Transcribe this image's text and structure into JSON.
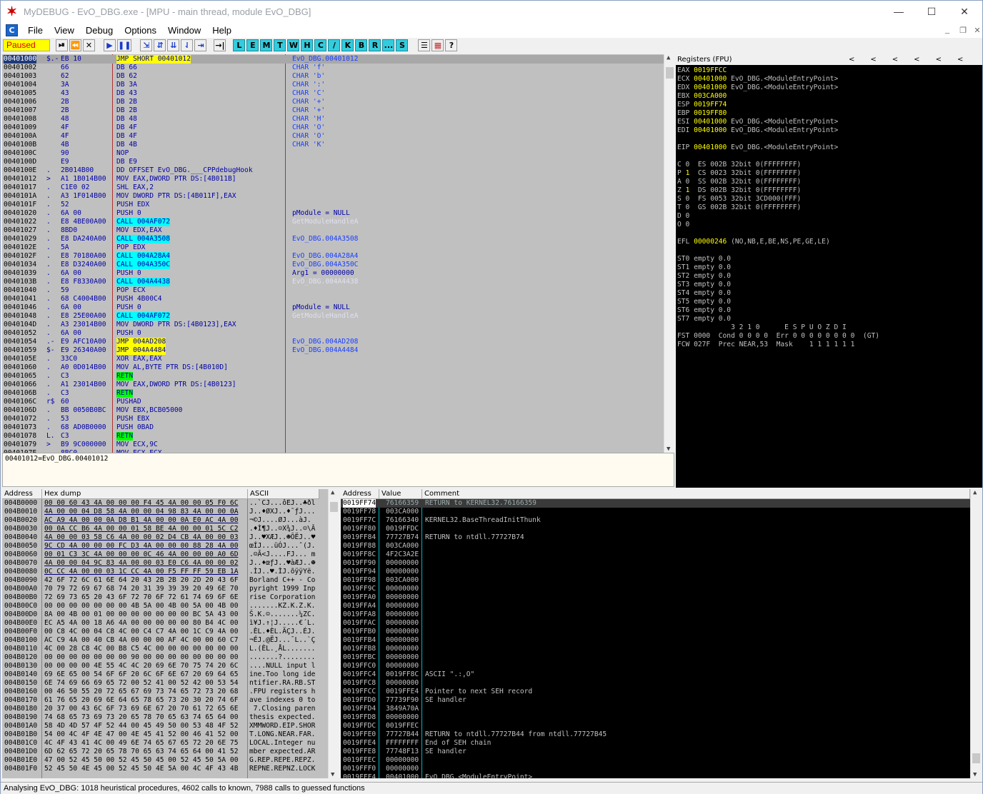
{
  "window": {
    "title": "MyDEBUG - EvO_DBG.exe - [MPU - main thread, module EvO_DBG]",
    "minimize": "—",
    "maximize": "☐",
    "close": "✕"
  },
  "menu": [
    "File",
    "View",
    "Debug",
    "Options",
    "Window",
    "Help"
  ],
  "toolbar": {
    "status": "Paused",
    "buttons": [
      "⏯",
      "⏪",
      "✕",
      "▶",
      "❚❚",
      "⇲",
      "⇵",
      "⇊",
      "⇃",
      "⇥",
      "→|"
    ],
    "letter_buttons": [
      "L",
      "E",
      "M",
      "T",
      "W",
      "H",
      "C",
      "/",
      "K",
      "B",
      "R",
      "...",
      "S"
    ],
    "misc_buttons": [
      "☰",
      "▦",
      "?"
    ]
  },
  "disasm": [
    [
      "00401000",
      "$.-",
      "EB 10",
      "JMP SHORT 00401012",
      "EvO_DBG.00401012"
    ],
    [
      "00401002",
      "",
      "66",
      "DB 66",
      "CHAR 'f'"
    ],
    [
      "00401003",
      "",
      "62",
      "DB 62",
      "CHAR 'b'"
    ],
    [
      "00401004",
      "",
      "3A",
      "DB 3A",
      "CHAR ':'"
    ],
    [
      "00401005",
      "",
      "43",
      "DB 43",
      "CHAR 'C'"
    ],
    [
      "00401006",
      "",
      "2B",
      "DB 2B",
      "CHAR '+'"
    ],
    [
      "00401007",
      "",
      "2B",
      "DB 2B",
      "CHAR '+'"
    ],
    [
      "00401008",
      "",
      "48",
      "DB 48",
      "CHAR 'H'"
    ],
    [
      "00401009",
      "",
      "4F",
      "DB 4F",
      "CHAR 'O'"
    ],
    [
      "0040100A",
      "",
      "4F",
      "DB 4F",
      "CHAR 'O'"
    ],
    [
      "0040100B",
      "",
      "4B",
      "DB 4B",
      "CHAR 'K'"
    ],
    [
      "0040100C",
      "",
      "90",
      "NOP",
      ""
    ],
    [
      "0040100D",
      "",
      "E9",
      "DB E9",
      ""
    ],
    [
      "0040100E",
      ".",
      "2B014B00",
      "DD OFFSET EvO_DBG.___CPPdebugHook",
      ""
    ],
    [
      "00401012",
      ">",
      "A1 1B014B00",
      "MOV EAX,DWORD PTR DS:[4B011B]",
      ""
    ],
    [
      "00401017",
      ".",
      "C1E0 02",
      "SHL EAX,2",
      ""
    ],
    [
      "0040101A",
      ".",
      "A3 1F014B00",
      "MOV DWORD PTR DS:[4B011F],EAX",
      ""
    ],
    [
      "0040101F",
      ".",
      "52",
      "PUSH EDX",
      ""
    ],
    [
      "00401020",
      ".",
      "6A 00",
      "PUSH 0",
      "pModule = NULL"
    ],
    [
      "00401022",
      ".",
      "E8 4BE00A00",
      "CALL 004AF072",
      "GetModuleHandleA"
    ],
    [
      "00401027",
      ".",
      "8BD0",
      "MOV EDX,EAX",
      ""
    ],
    [
      "00401029",
      ".",
      "E8 DA240A00",
      "CALL 004A3508",
      "EvO_DBG.004A3508"
    ],
    [
      "0040102E",
      ".",
      "5A",
      "POP EDX",
      ""
    ],
    [
      "0040102F",
      ".",
      "E8 70180A00",
      "CALL 004A28A4",
      "EvO_DBG.004A28A4"
    ],
    [
      "00401034",
      ".",
      "E8 D3240A00",
      "CALL 004A350C",
      "EvO_DBG.004A350C"
    ],
    [
      "00401039",
      ".",
      "6A 00",
      "PUSH 0",
      "Arg1 = 00000000"
    ],
    [
      "0040103B",
      ".",
      "E8 F8330A00",
      "CALL 004A4438",
      "EvO_DBG.004A4438"
    ],
    [
      "00401040",
      ".",
      "59",
      "POP ECX",
      ""
    ],
    [
      "00401041",
      ".",
      "68 C4004B00",
      "PUSH 4B00C4",
      ""
    ],
    [
      "00401046",
      ".",
      "6A 00",
      "PUSH 0",
      "pModule = NULL"
    ],
    [
      "00401048",
      ".",
      "E8 25E00A00",
      "CALL 004AF072",
      "GetModuleHandleA"
    ],
    [
      "0040104D",
      ".",
      "A3 23014B00",
      "MOV DWORD PTR DS:[4B0123],EAX",
      ""
    ],
    [
      "00401052",
      ".",
      "6A 00",
      "PUSH 0",
      ""
    ],
    [
      "00401054",
      ".-",
      "E9 AFC10A00",
      "JMP 004AD208",
      "EvO_DBG.004AD208"
    ],
    [
      "00401059",
      "$-",
      "E9 26340A00",
      "JMP 004A4484",
      "EvO_DBG.004A4484"
    ],
    [
      "0040105E",
      ".",
      "33C0",
      "XOR EAX,EAX",
      ""
    ],
    [
      "00401060",
      ".",
      "A0 0D014B00",
      "MOV AL,BYTE PTR DS:[4B010D]",
      ""
    ],
    [
      "00401065",
      ".",
      "C3",
      "RETN",
      ""
    ],
    [
      "00401066",
      ".",
      "A1 23014B00",
      "MOV EAX,DWORD PTR DS:[4B0123]",
      ""
    ],
    [
      "0040106B",
      ".",
      "C3",
      "RETN",
      ""
    ],
    [
      "0040106C",
      "r$",
      "60",
      "PUSHAD",
      ""
    ],
    [
      "0040106D",
      ".",
      "BB 0050B0BC",
      "MOV EBX,BCB05000",
      ""
    ],
    [
      "00401072",
      ".",
      "53",
      "PUSH EBX",
      ""
    ],
    [
      "00401073",
      ".",
      "68 AD0B0000",
      "PUSH 0BAD",
      ""
    ],
    [
      "00401078",
      "L.",
      "C3",
      "RETN",
      ""
    ],
    [
      "00401079",
      ">",
      "B9 9C000000",
      "MOV ECX,9C",
      ""
    ],
    [
      "0040107E",
      ".",
      "8BC0",
      "MOV ECX,ECX",
      ""
    ]
  ],
  "info_line": "00401012=EvO_DBG.00401012",
  "registers": {
    "title": "Registers (FPU)",
    "arrows": [
      "<",
      "<",
      "<",
      "<",
      "<",
      "<"
    ],
    "lines": [
      [
        "EAX",
        "0019FFCC",
        ""
      ],
      [
        "ECX",
        "00401000",
        "EvO_DBG.<ModuleEntryPoint>"
      ],
      [
        "EDX",
        "00401000",
        "EvO_DBG.<ModuleEntryPoint>"
      ],
      [
        "EBX",
        "003CA000",
        ""
      ],
      [
        "ESP",
        "0019FF74",
        ""
      ],
      [
        "EBP",
        "0019FF80",
        ""
      ],
      [
        "ESI",
        "00401000",
        "EvO_DBG.<ModuleEntryPoint>"
      ],
      [
        "EDI",
        "00401000",
        "EvO_DBG.<ModuleEntryPoint>"
      ],
      [
        "",
        "",
        ""
      ],
      [
        "EIP",
        "00401000",
        "EvO_DBG.<ModuleEntryPoint>"
      ]
    ],
    "flags": [
      "C 0  ES 002B 32bit 0(FFFFFFFF)",
      "P 1  CS 0023 32bit 0(FFFFFFFF)",
      "A 0  SS 002B 32bit 0(FFFFFFFF)",
      "Z 1  DS 002B 32bit 0(FFFFFFFF)",
      "S 0  FS 0053 32bit 3CD000(FFF)",
      "T 0  GS 002B 32bit 0(FFFFFFFF)",
      "D 0",
      "O 0"
    ],
    "efl_label": "EFL",
    "efl_value": "00000246",
    "efl_desc": "(NO,NB,E,BE,NS,PE,GE,LE)",
    "fpu": [
      "ST0 empty 0.0",
      "ST1 empty 0.0",
      "ST2 empty 0.0",
      "ST3 empty 0.0",
      "ST4 empty 0.0",
      "ST5 empty 0.0",
      "ST6 empty 0.0",
      "ST7 empty 0.0",
      "             3 2 1 0      E S P U O Z D I",
      "FST 0000  Cond 0 0 0 0  Err 0 0 0 0 0 0 0 0  (GT)",
      "FCW 027F  Prec NEAR,53  Mask    1 1 1 1 1 1"
    ]
  },
  "dump": {
    "headers": [
      "Address",
      "Hex dump",
      "ASCII"
    ],
    "rows": [
      [
        "004B0000",
        "00 00 60 43 4A 00 00 00 F4 45 4A 00 00 05 F0 6C",
        "..`CJ...ôEJ..♣ðl"
      ],
      [
        "004B0010",
        "4A 00 00 04 D8 58 4A 00 00 04 98 83 4A 00 00 0A",
        "J..♦ØXJ..♦˜ƒJ..."
      ],
      [
        "004B0020",
        "AC A9 4A 00 00 0A D8 B1 4A 00 00 0A E0 AC 4A 00",
        "¬©J....ØJ...àJ."
      ],
      [
        "004B0030",
        "00 0A CC B6 4A 00 00 01 58 BE 4A 00 00 01 5C C2",
        ".♦Ì¶J..☺X¾J..☺\\Â"
      ],
      [
        "004B0040",
        "4A 00 00 03 58 C6 4A 00 00 02 D4 CB 4A 00 00 03",
        "J..♥XÆJ..☻ÔËJ..♥"
      ],
      [
        "004B0050",
        "9C CD 4A 00 00 00 FC D3 4A 00 00 00 88 28 4A 00",
        "œÍJ...üÓJ...ˆ(J."
      ],
      [
        "004B0060",
        "00 01 C3 3C 4A 00 00 00 0C 46 4A 00 00 00 A0 6D",
        ".☺Ã<J....FJ... m"
      ],
      [
        "004B0070",
        "4A 00 00 04 9C 83 4A 00 00 03 E0 C6 4A 00 00 02",
        "J..♦œƒJ..♥àÆJ..☻"
      ],
      [
        "004B0080",
        "0C CC 4A 00 00 03 1C CC 4A 00 F5 FF FF 59 EB 1A",
        ".ÌJ..♥.ÌJ.õÿÿYë."
      ],
      [
        "004B0090",
        "42 6F 72 6C 61 6E 64 20 43 2B 2B 20 2D 20 43 6F",
        "Borland C++ - Co"
      ],
      [
        "004B00A0",
        "70 79 72 69 67 68 74 20 31 39 39 39 20 49 6E 70",
        "pyright 1999 Inp"
      ],
      [
        "004B00B0",
        "72 69 73 65 20 43 6F 72 70 6F 72 61 74 69 6F 6E",
        "rise Corporation"
      ],
      [
        "004B00C0",
        "00 00 00 00 00 00 00 4B 5A 00 4B 00 5A 00 4B 00",
        ".......KZ.K.Z.K."
      ],
      [
        "004B00D0",
        "8A 00 4B 00 01 00 00 00 00 00 00 00 BC 5A 43 00",
        "Š.K.☺.......¼ZC."
      ],
      [
        "004B00E0",
        "EC A5 4A 00 18 A6 4A 00 00 00 00 00 80 B4 4C 00",
        "ì¥J.↑¦J.....€´L."
      ],
      [
        "004B00F0",
        "00 C8 4C 00 04 C8 4C 00 C4 C7 4A 00 1C C9 4A 00",
        ".ÈL.♦ÈL.ÄÇJ..ÉJ."
      ],
      [
        "004B0100",
        "AC C9 4A 00 40 CB 4A 00 00 00 AF 4C 00 00 60 C7",
        "¬ÉJ.@ËJ...¯L..`Ç"
      ],
      [
        "004B0110",
        "4C 00 28 C8 4C 00 B8 C5 4C 00 00 00 00 00 00 00",
        "L.(ÈL.¸ÅL......."
      ],
      [
        "004B0120",
        "00 00 00 00 00 00 00 90 00 00 00 00 00 00 00 00",
        ".......?........"
      ],
      [
        "004B0130",
        "00 00 00 00 4E 55 4C 4C 20 69 6E 70 75 74 20 6C",
        "....NULL input l"
      ],
      [
        "004B0140",
        "69 6E 65 00 54 6F 6F 20 6C 6F 6E 67 20 69 64 65",
        "ine.Too long ide"
      ],
      [
        "004B0150",
        "6E 74 69 66 69 65 72 00 52 41 00 52 42 00 53 54",
        "ntifier.RA.RB.ST"
      ],
      [
        "004B0160",
        "00 46 50 55 20 72 65 67 69 73 74 65 72 73 20 68",
        ".FPU registers h"
      ],
      [
        "004B0170",
        "61 76 65 20 69 6E 64 65 78 65 73 20 30 20 74 6F",
        "ave indexes 0 to"
      ],
      [
        "004B0180",
        "20 37 00 43 6C 6F 73 69 6E 67 20 70 61 72 65 6E",
        " 7.Closing paren"
      ],
      [
        "004B0190",
        "74 68 65 73 69 73 20 65 78 70 65 63 74 65 64 00",
        "thesis expected."
      ],
      [
        "004B01A0",
        "58 4D 4D 57 4F 52 44 00 45 49 50 00 53 48 4F 52",
        "XMMWORD.EIP.SHOR"
      ],
      [
        "004B01B0",
        "54 00 4C 4F 4E 47 00 4E 45 41 52 00 46 41 52 00",
        "T.LONG.NEAR.FAR."
      ],
      [
        "004B01C0",
        "4C 4F 43 41 4C 00 49 6E 74 65 67 65 72 20 6E 75",
        "LOCAL.Integer nu"
      ],
      [
        "004B01D0",
        "6D 62 65 72 20 65 78 70 65 63 74 65 64 00 41 52",
        "mber expected.AR"
      ],
      [
        "004B01E0",
        "47 00 52 45 50 00 52 45 50 45 00 52 45 50 5A 00",
        "G.REP.REPE.REPZ."
      ],
      [
        "004B01F0",
        "52 45 50 4E 45 00 52 45 50 4E 5A 00 4C 4F 43 4B",
        "REPNE.REPNZ.LOCK"
      ]
    ]
  },
  "stack": {
    "headers": [
      "Address",
      "Value",
      "Comment"
    ],
    "rows": [
      [
        "0019FF74",
        "76166359",
        "RETURN to KERNEL32.76166359"
      ],
      [
        "0019FF78",
        "003CA000",
        ""
      ],
      [
        "0019FF7C",
        "76166340",
        "KERNEL32.BaseThreadInitThunk"
      ],
      [
        "0019FF80",
        "0019FFDC",
        ""
      ],
      [
        "0019FF84",
        "77727B74",
        "RETURN to ntdll.77727B74"
      ],
      [
        "0019FF88",
        "003CA000",
        ""
      ],
      [
        "0019FF8C",
        "4F2C3A2E",
        ""
      ],
      [
        "0019FF90",
        "00000000",
        ""
      ],
      [
        "0019FF94",
        "00000000",
        ""
      ],
      [
        "0019FF98",
        "003CA000",
        ""
      ],
      [
        "0019FF9C",
        "00000000",
        ""
      ],
      [
        "0019FFA0",
        "00000000",
        ""
      ],
      [
        "0019FFA4",
        "00000000",
        ""
      ],
      [
        "0019FFA8",
        "00000000",
        ""
      ],
      [
        "0019FFAC",
        "00000000",
        ""
      ],
      [
        "0019FFB0",
        "00000000",
        ""
      ],
      [
        "0019FFB4",
        "00000000",
        ""
      ],
      [
        "0019FFB8",
        "00000000",
        ""
      ],
      [
        "0019FFBC",
        "00000000",
        ""
      ],
      [
        "0019FFC0",
        "00000000",
        ""
      ],
      [
        "0019FFC4",
        "0019FF8C",
        "ASCII \".:,O\""
      ],
      [
        "0019FFC8",
        "00000000",
        ""
      ],
      [
        "0019FFCC",
        "0019FFE4",
        "Pointer to next SEH record"
      ],
      [
        "0019FFD0",
        "77739F90",
        "SE handler"
      ],
      [
        "0019FFD4",
        "3849A70A",
        ""
      ],
      [
        "0019FFD8",
        "00000000",
        ""
      ],
      [
        "0019FFDC",
        "0019FFEC",
        ""
      ],
      [
        "0019FFE0",
        "77727B44",
        "RETURN to ntdll.77727B44 from ntdll.77727B45"
      ],
      [
        "0019FFE4",
        "FFFFFFFF",
        "End of SEH chain"
      ],
      [
        "0019FFE8",
        "77748F13",
        "SE handler"
      ],
      [
        "0019FFEC",
        "00000000",
        ""
      ],
      [
        "0019FFF0",
        "00000000",
        ""
      ],
      [
        "0019FFF4",
        "00401000",
        "EvO_DBG.<ModuleEntryPoint>"
      ]
    ]
  },
  "statusbar": "Analysing EvO_DBG: 1018 heuristical procedures, 4602 calls to known, 7988 calls to guessed functions",
  "colors": {
    "highlight_yellow": "#ffff00",
    "highlight_cyan": "#00ffff",
    "highlight_green": "#00ff00",
    "register_bg": "#000000",
    "register_changed": "#ffff00"
  }
}
